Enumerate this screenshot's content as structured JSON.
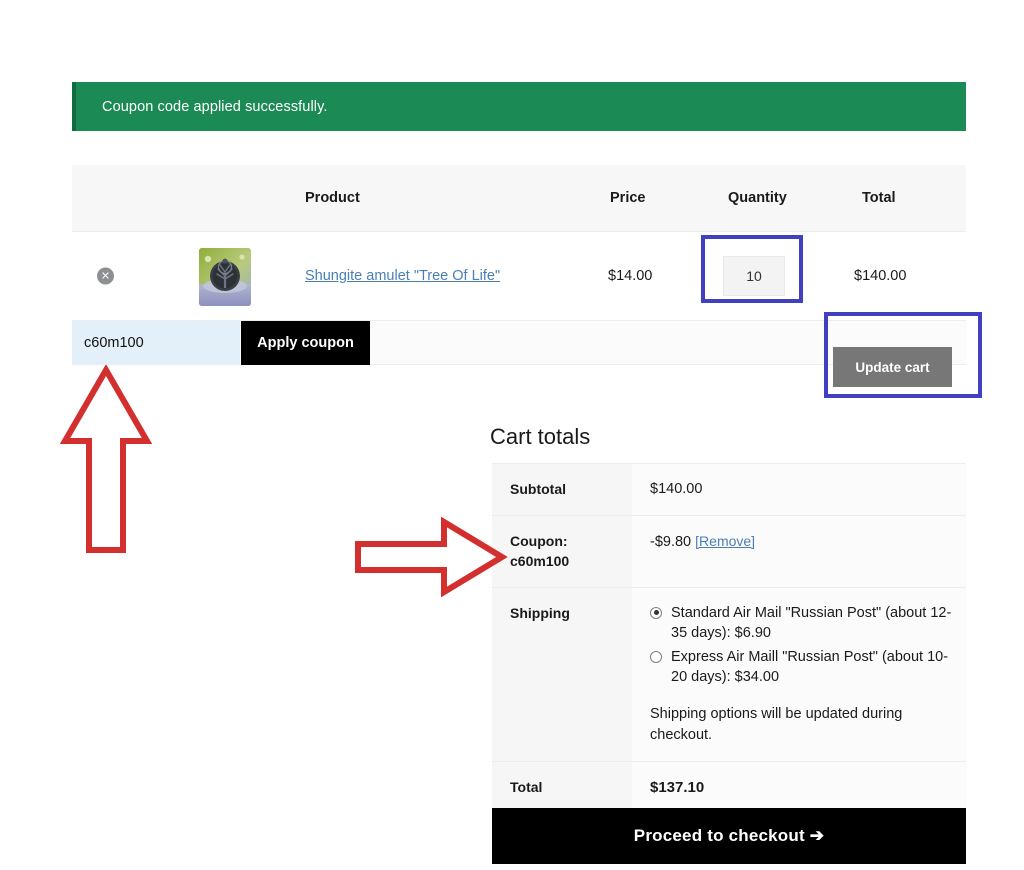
{
  "notice": {
    "message": "Coupon code applied successfully.",
    "background_color": "#1c8a55"
  },
  "cart_table": {
    "headers": {
      "product": "Product",
      "price": "Price",
      "quantity": "Quantity",
      "total": "Total"
    },
    "rows": [
      {
        "remove_icon": "remove-circle-icon",
        "remove_glyph": "✕",
        "thumbnail": "product-thumbnail-shungite-amulet",
        "name": "Shungite amulet \"Tree Of Life\"",
        "price": "$14.00",
        "quantity": "10",
        "total": "$140.00"
      }
    ]
  },
  "coupon_bar": {
    "code_value": "c60m100",
    "code_placeholder": "Coupon code",
    "apply_label": "Apply coupon",
    "update_cart_label": "Update cart"
  },
  "highlights": {
    "color": "#4040c0",
    "quantity_box": "quantity-field-highlight",
    "update_cart_box": "update-cart-highlight"
  },
  "annotations": {
    "color": "#d32f2f",
    "arrow_up": "arrow-pointing-to-coupon-input",
    "arrow_right": "arrow-pointing-to-coupon-row"
  },
  "cart_totals": {
    "title": "Cart totals",
    "subtotal": {
      "label": "Subtotal",
      "value": "$140.00"
    },
    "coupon": {
      "label": "Coupon: c60m100",
      "label_line1": "Coupon:",
      "label_line2": "c60m100",
      "value": "-$9.80",
      "remove_label": "[Remove]"
    },
    "shipping": {
      "label": "Shipping",
      "options": [
        {
          "label": "Standard Air Mail \"Russian Post\" (about 12-35 days): $6.90",
          "selected": true
        },
        {
          "label": "Express Air Maill \"Russian Post\" (about 10-20 days): $34.00",
          "selected": false
        }
      ],
      "note": "Shipping options will be updated during checkout."
    },
    "total": {
      "label": "Total",
      "value": "$137.10"
    }
  },
  "checkout": {
    "label": "Proceed to checkout",
    "arrow_glyph": "➔"
  }
}
